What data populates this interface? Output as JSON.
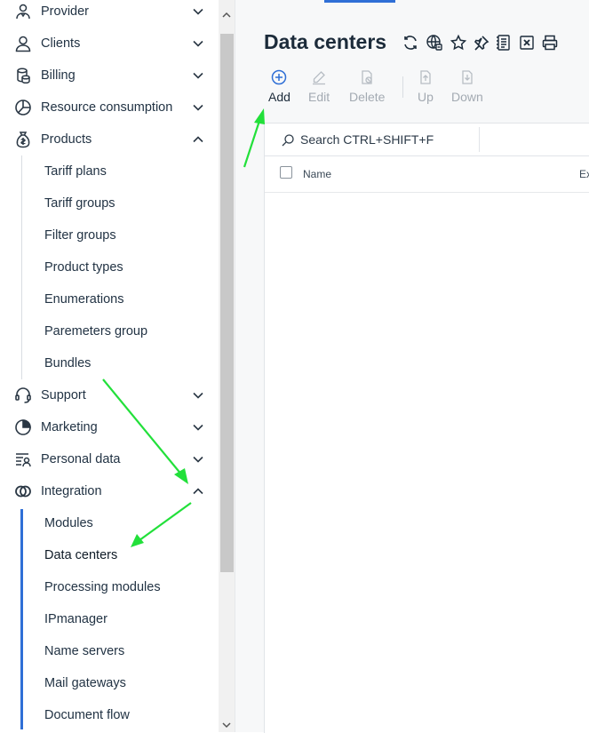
{
  "sidebar": {
    "items": [
      {
        "label": "Provider",
        "icon": "provider-icon",
        "expanded": false
      },
      {
        "label": "Clients",
        "icon": "clients-icon",
        "expanded": false
      },
      {
        "label": "Billing",
        "icon": "billing-icon",
        "expanded": false
      },
      {
        "label": "Resource consumption",
        "icon": "resource-consumption-icon",
        "expanded": false
      },
      {
        "label": "Products",
        "icon": "products-icon",
        "expanded": true
      },
      {
        "label": "Support",
        "icon": "support-icon",
        "expanded": false
      },
      {
        "label": "Marketing",
        "icon": "marketing-icon",
        "expanded": false
      },
      {
        "label": "Personal data",
        "icon": "personal-data-icon",
        "expanded": false
      },
      {
        "label": "Integration",
        "icon": "integration-icon",
        "expanded": true
      }
    ],
    "products_children": [
      "Tariff plans",
      "Tariff groups",
      "Filter groups",
      "Product types",
      "Enumerations",
      "Paremeters group",
      "Bundles"
    ],
    "integration_children": [
      "Modules",
      "Data centers",
      "Processing modules",
      "IPmanager",
      "Name servers",
      "Mail gateways",
      "Document flow"
    ],
    "active_item": "Data centers",
    "accent_color": "#2f6fd6"
  },
  "page": {
    "title": "Data centers",
    "title_icons": [
      "refresh-icon",
      "globe-link-icon",
      "star-icon",
      "pin-icon",
      "document-icon",
      "excel-export-icon",
      "print-icon"
    ]
  },
  "toolbar": {
    "add_label": "Add",
    "edit_label": "Edit",
    "delete_label": "Delete",
    "up_label": "Up",
    "down_label": "Down"
  },
  "search": {
    "placeholder": "Search CTRL+SHIFT+F"
  },
  "table": {
    "columns": [
      "Name",
      "Ex"
    ]
  },
  "annotation_color": "#22e03a"
}
